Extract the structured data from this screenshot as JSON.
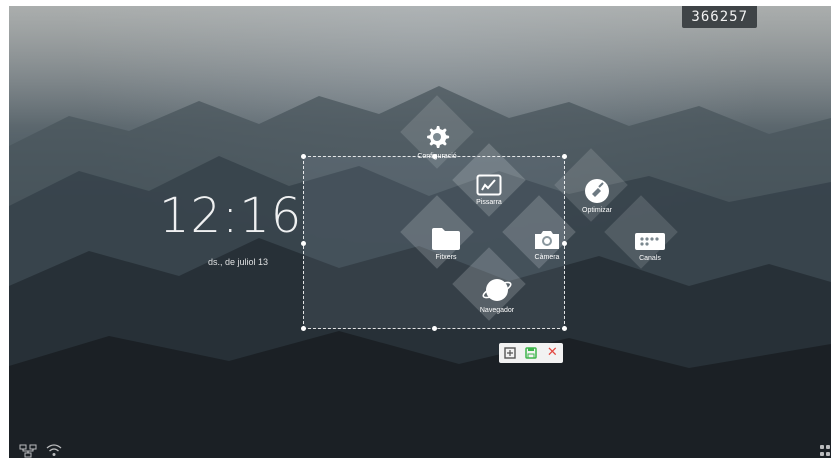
{
  "screen": {
    "code": "366257",
    "clock_time": "12:16",
    "date": "ds., de juliol 13"
  },
  "apps": {
    "configuracio": "Configuració",
    "pissarra": "Pissarra",
    "optimizar": "Optimizar",
    "fitxers": "Fitxers",
    "camera": "Càmera",
    "canals": "Canals",
    "navegador": "Navegador"
  },
  "toolbar": {
    "icons": [
      "fullscreen-icon",
      "save-icon",
      "close-icon"
    ],
    "close_glyph": "✕"
  },
  "colors": {
    "save_icon": "#3cb54a",
    "close_icon": "#e2463f",
    "toolbar_bg": "#f2f2f2"
  },
  "status": {
    "icons": [
      "network-icon",
      "wifi-icon",
      "apps-grid-icon"
    ]
  }
}
